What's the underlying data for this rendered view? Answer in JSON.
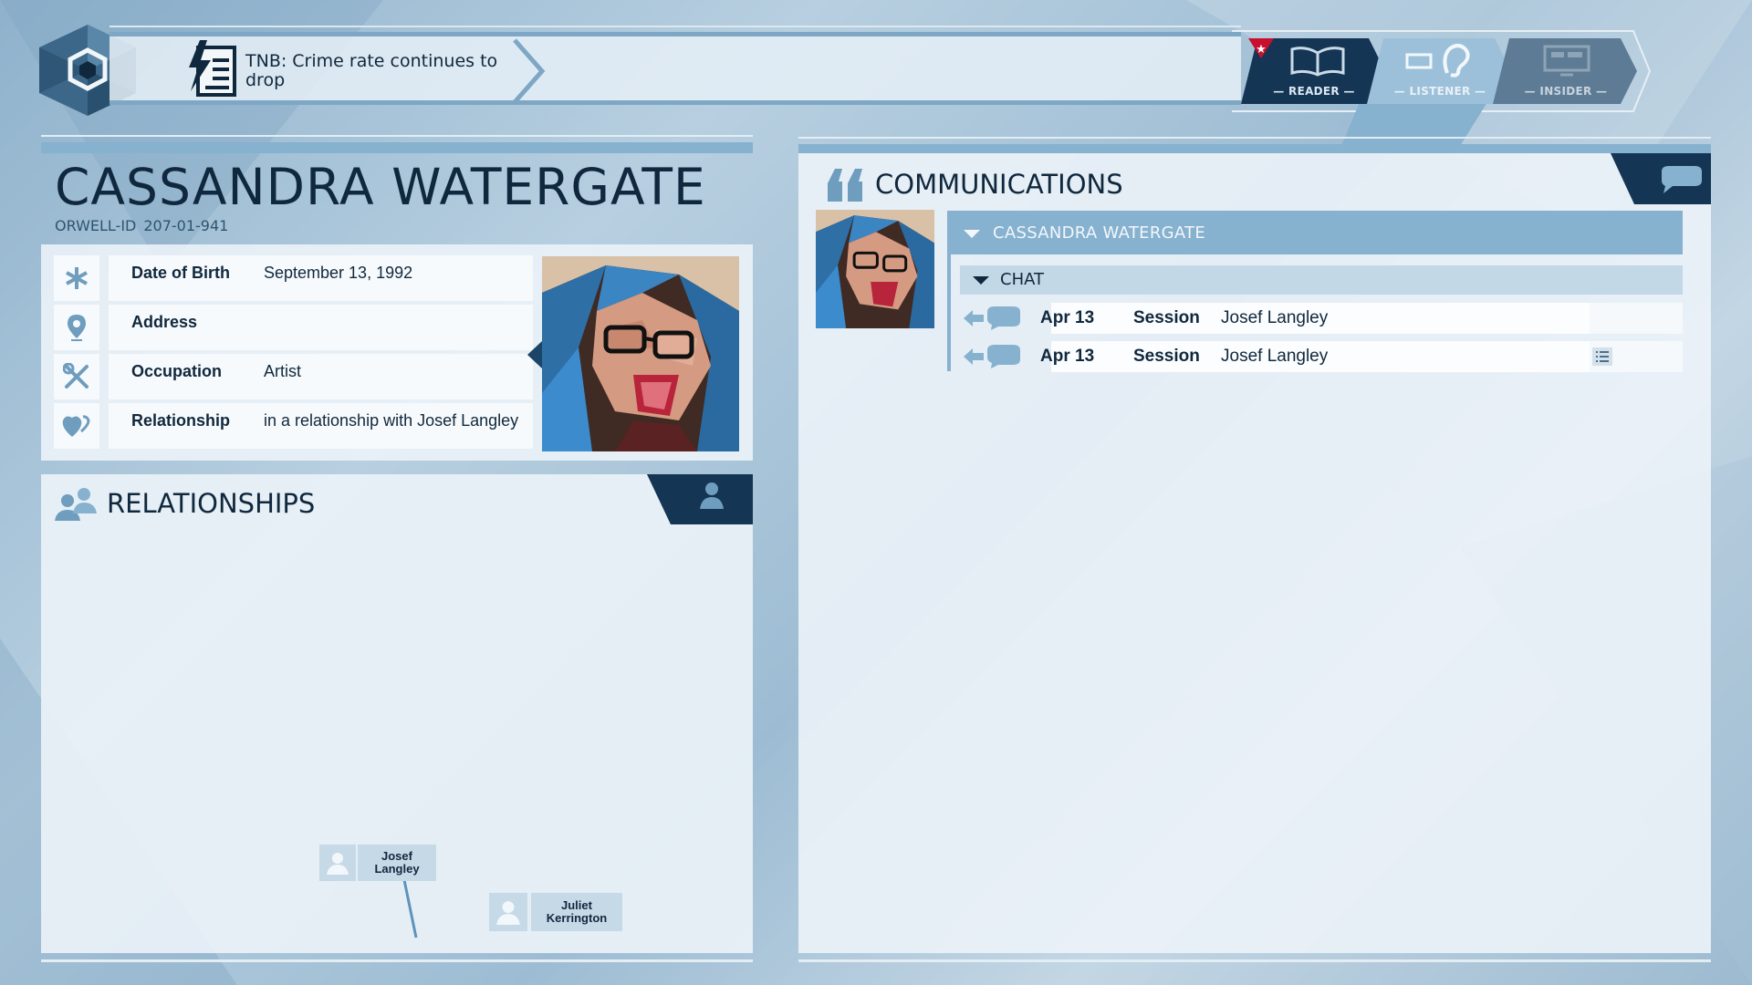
{
  "news": {
    "headline": "TNB: Crime rate continues to drop",
    "icon": "news-flash-icon"
  },
  "roles": [
    {
      "label": "— READER —",
      "icon": "open-book-icon",
      "badge": "star-badge-icon",
      "state": "active-dark"
    },
    {
      "label": "— LISTENER —",
      "icon": "ear-icon",
      "state": "selected"
    },
    {
      "label": "— INSIDER —",
      "icon": "monitor-icon",
      "state": "locked"
    }
  ],
  "profile": {
    "name": "CASSANDRA WATERGATE",
    "id_label": "ORWELL-ID",
    "id_value": "207-01-941",
    "fields": [
      {
        "icon": "asterisk-icon",
        "key": "Date of Birth",
        "value": "September 13, 1992"
      },
      {
        "icon": "location-pin-icon",
        "key": "Address",
        "value": ""
      },
      {
        "icon": "tools-icon",
        "key": "Occupation",
        "value": "Artist"
      },
      {
        "icon": "heart-icon",
        "key": "Relationship",
        "value": "in a relationship with Josef Langley"
      }
    ]
  },
  "relationships": {
    "title": "RELATIONSHIPS",
    "nodes": [
      {
        "name": "Josef Langley"
      },
      {
        "name": "Juliet Kerrington"
      }
    ]
  },
  "communications": {
    "title": "COMMUNICATIONS",
    "thread_name": "CASSANDRA WATERGATE",
    "group": "CHAT",
    "messages": [
      {
        "date": "Apr 13",
        "type": "Session",
        "with": "Josef Langley",
        "has_list": false
      },
      {
        "date": "Apr 13",
        "type": "Session",
        "with": "Josef Langley",
        "has_list": true
      }
    ]
  },
  "colors": {
    "accent": "#86b1cf",
    "dark": "#10283d",
    "reader_red": "#c8102e"
  }
}
